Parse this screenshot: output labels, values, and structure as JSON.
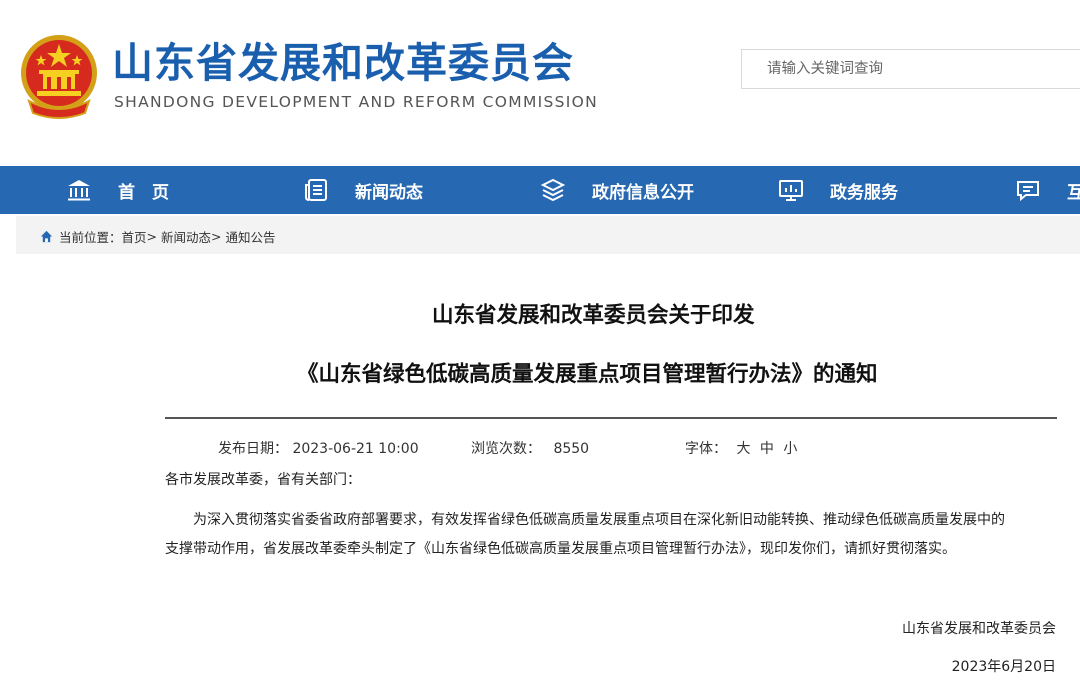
{
  "header": {
    "title": "山东省发展和改革委员会",
    "subtitle": "SHANDONG DEVELOPMENT AND REFORM COMMISSION",
    "search_placeholder": "请输入关键词查询"
  },
  "nav": {
    "items": [
      {
        "label": "首　页",
        "icon": "government-building-icon"
      },
      {
        "label": "新闻动态",
        "icon": "news-list-icon"
      },
      {
        "label": "政府信息公开",
        "icon": "layers-icon"
      },
      {
        "label": "政务服务",
        "icon": "monitor-chart-icon"
      },
      {
        "label": "互",
        "icon": "chat-bubble-icon"
      }
    ]
  },
  "breadcrumb": {
    "prefix": "当前位置：",
    "items": [
      "首页",
      "新闻动态",
      "通知公告"
    ],
    "separator": ">"
  },
  "article": {
    "title_line1": "山东省发展和改革委员会关于印发",
    "title_line2": "《山东省绿色低碳高质量发展重点项目管理暂行办法》的通知",
    "meta": {
      "date_label": "发布日期：",
      "date_value": "2023-06-21 10:00",
      "views_label": "浏览次数：",
      "views_value": "8550",
      "font_label": "字体：",
      "font_large": "大",
      "font_medium": "中",
      "font_small": "小"
    },
    "salutation": "各市发展改革委，省有关部门：",
    "body_line1": "为深入贯彻落实省委省政府部署要求，有效发挥省绿色低碳高质量发展重点项目在深化新旧动能转换、推动绿色低碳高质量发展中的",
    "body_line2": "支撑带动作用，省发展改革委牵头制定了《山东省绿色低碳高质量发展重点项目管理暂行办法》，现印发你们，请抓好贯彻落实。",
    "signature": "山东省发展和改革委员会",
    "sign_date": "2023年6月20日"
  },
  "colors": {
    "brand_blue": "#1a5fae",
    "nav_bg": "#2668b1",
    "breadcrumb_bg": "#f3f3f3"
  }
}
